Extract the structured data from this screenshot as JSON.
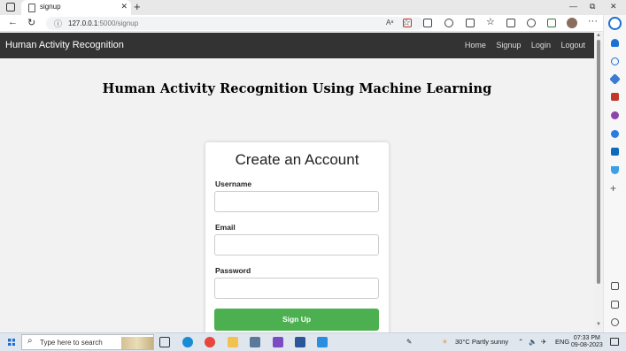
{
  "browser": {
    "tab_title": "signup",
    "tab_close": "✕",
    "new_tab": "+",
    "window_controls": [
      "—",
      "⧉",
      "✕"
    ],
    "url_host": "127.0.0.1",
    "url_path": ":5000/signup",
    "read_aloud": "Aᵃ",
    "favorite": "☆",
    "more": "···"
  },
  "nav": {
    "brand": "Human Activity Recognition",
    "links": [
      "Home",
      "Signup",
      "Login",
      "Logout"
    ]
  },
  "page": {
    "heading": "Human Activity Recognition Using Machine Learning"
  },
  "form": {
    "title": "Create an Account",
    "username_label": "Username",
    "username_value": "",
    "email_label": "Email",
    "email_value": "",
    "password_label": "Password",
    "password_value": "",
    "submit_label": "Sign Up"
  },
  "taskbar": {
    "search_placeholder": "Type here to search",
    "weather": "30°C  Partly sunny",
    "language": "ENG",
    "time": "07:33 PM",
    "date": "09-08-2023"
  },
  "colors": {
    "navbar": "#333333",
    "button": "#4caf50",
    "page_bg": "#f2f2f2",
    "accent_edge": "#1b6fd6"
  }
}
